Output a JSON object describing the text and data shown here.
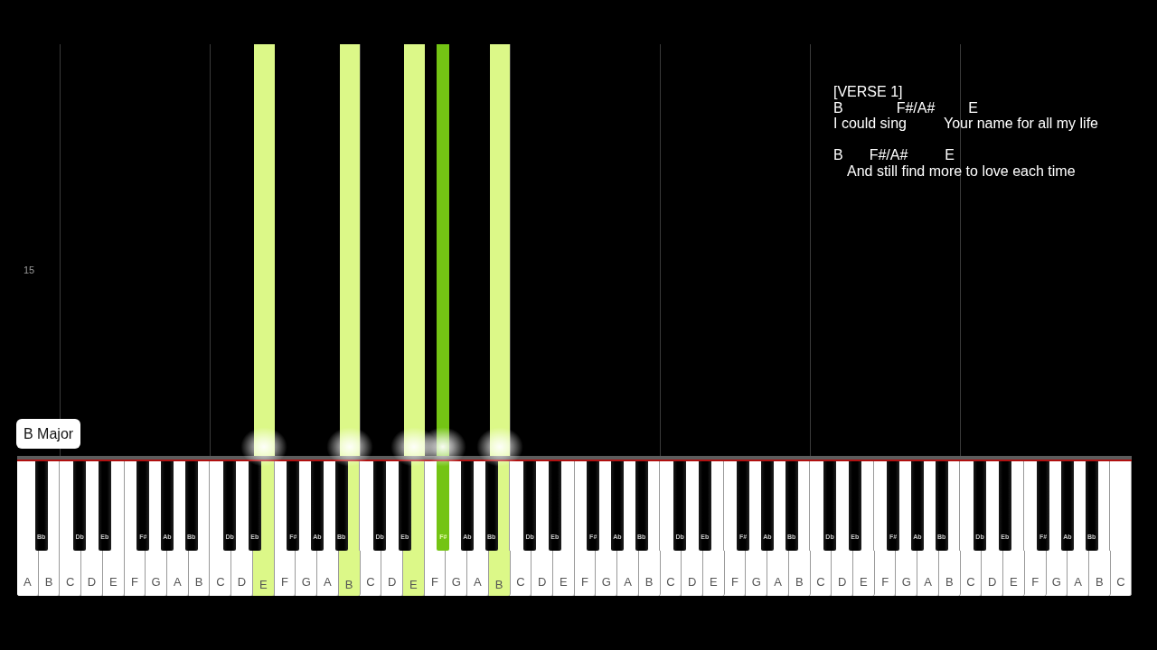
{
  "roll": {
    "measure_number": "15",
    "chord_label": "B Major"
  },
  "lyrics": {
    "section": "[VERSE 1]",
    "lines": [
      {
        "chords": [
          "B",
          "F#/A#",
          "E"
        ],
        "words": [
          "I could sing",
          "Your name for all my life"
        ]
      },
      {
        "chords": [
          "B",
          "F#/A#",
          "E"
        ],
        "words": [
          "And still find more to love each time"
        ]
      }
    ]
  },
  "keys": [
    {
      "kind": "white",
      "label": "A",
      "pressed": false
    },
    {
      "kind": "black",
      "label": "Bb",
      "pressed": false
    },
    {
      "kind": "white",
      "label": "B",
      "pressed": false
    },
    {
      "kind": "white",
      "label": "C",
      "pressed": false
    },
    {
      "kind": "black",
      "label": "Db",
      "pressed": false
    },
    {
      "kind": "white",
      "label": "D",
      "pressed": false
    },
    {
      "kind": "black",
      "label": "Eb",
      "pressed": false
    },
    {
      "kind": "white",
      "label": "E",
      "pressed": false
    },
    {
      "kind": "white",
      "label": "F",
      "pressed": false
    },
    {
      "kind": "black",
      "label": "F#",
      "pressed": false
    },
    {
      "kind": "white",
      "label": "G",
      "pressed": false
    },
    {
      "kind": "black",
      "label": "Ab",
      "pressed": false
    },
    {
      "kind": "white",
      "label": "A",
      "pressed": false
    },
    {
      "kind": "black",
      "label": "Bb",
      "pressed": false
    },
    {
      "kind": "white",
      "label": "B",
      "pressed": false
    },
    {
      "kind": "white",
      "label": "C",
      "pressed": false
    },
    {
      "kind": "black",
      "label": "Db",
      "pressed": false
    },
    {
      "kind": "white",
      "label": "D",
      "pressed": false
    },
    {
      "kind": "black",
      "label": "Eb",
      "pressed": false
    },
    {
      "kind": "white",
      "label": "E",
      "pressed": true,
      "color": "#dcf888"
    },
    {
      "kind": "white",
      "label": "F",
      "pressed": false
    },
    {
      "kind": "black",
      "label": "F#",
      "pressed": false
    },
    {
      "kind": "white",
      "label": "G",
      "pressed": false
    },
    {
      "kind": "black",
      "label": "Ab",
      "pressed": false
    },
    {
      "kind": "white",
      "label": "A",
      "pressed": false
    },
    {
      "kind": "black",
      "label": "Bb",
      "pressed": false
    },
    {
      "kind": "white",
      "label": "B",
      "pressed": true,
      "color": "#dcf888"
    },
    {
      "kind": "white",
      "label": "C",
      "pressed": false
    },
    {
      "kind": "black",
      "label": "Db",
      "pressed": false
    },
    {
      "kind": "white",
      "label": "D",
      "pressed": false
    },
    {
      "kind": "black",
      "label": "Eb",
      "pressed": false
    },
    {
      "kind": "white",
      "label": "E",
      "pressed": true,
      "color": "#dcf888"
    },
    {
      "kind": "white",
      "label": "F",
      "pressed": false
    },
    {
      "kind": "black",
      "label": "F#",
      "pressed": true,
      "color": "#74c414"
    },
    {
      "kind": "white",
      "label": "G",
      "pressed": false
    },
    {
      "kind": "black",
      "label": "Ab",
      "pressed": false
    },
    {
      "kind": "white",
      "label": "A",
      "pressed": false
    },
    {
      "kind": "black",
      "label": "Bb",
      "pressed": false
    },
    {
      "kind": "white",
      "label": "B",
      "pressed": true,
      "color": "#dcf888"
    },
    {
      "kind": "white",
      "label": "C",
      "pressed": false
    },
    {
      "kind": "black",
      "label": "Db",
      "pressed": false
    },
    {
      "kind": "white",
      "label": "D",
      "pressed": false
    },
    {
      "kind": "black",
      "label": "Eb",
      "pressed": false
    },
    {
      "kind": "white",
      "label": "E",
      "pressed": false
    },
    {
      "kind": "white",
      "label": "F",
      "pressed": false
    },
    {
      "kind": "black",
      "label": "F#",
      "pressed": false
    },
    {
      "kind": "white",
      "label": "G",
      "pressed": false
    },
    {
      "kind": "black",
      "label": "Ab",
      "pressed": false
    },
    {
      "kind": "white",
      "label": "A",
      "pressed": false
    },
    {
      "kind": "black",
      "label": "Bb",
      "pressed": false
    },
    {
      "kind": "white",
      "label": "B",
      "pressed": false
    },
    {
      "kind": "white",
      "label": "C",
      "pressed": false
    },
    {
      "kind": "black",
      "label": "Db",
      "pressed": false
    },
    {
      "kind": "white",
      "label": "D",
      "pressed": false
    },
    {
      "kind": "black",
      "label": "Eb",
      "pressed": false
    },
    {
      "kind": "white",
      "label": "E",
      "pressed": false
    },
    {
      "kind": "white",
      "label": "F",
      "pressed": false
    },
    {
      "kind": "black",
      "label": "F#",
      "pressed": false
    },
    {
      "kind": "white",
      "label": "G",
      "pressed": false
    },
    {
      "kind": "black",
      "label": "Ab",
      "pressed": false
    },
    {
      "kind": "white",
      "label": "A",
      "pressed": false
    },
    {
      "kind": "black",
      "label": "Bb",
      "pressed": false
    },
    {
      "kind": "white",
      "label": "B",
      "pressed": false
    },
    {
      "kind": "white",
      "label": "C",
      "pressed": false
    },
    {
      "kind": "black",
      "label": "Db",
      "pressed": false
    },
    {
      "kind": "white",
      "label": "D",
      "pressed": false
    },
    {
      "kind": "black",
      "label": "Eb",
      "pressed": false
    },
    {
      "kind": "white",
      "label": "E",
      "pressed": false
    },
    {
      "kind": "white",
      "label": "F",
      "pressed": false
    },
    {
      "kind": "black",
      "label": "F#",
      "pressed": false
    },
    {
      "kind": "white",
      "label": "G",
      "pressed": false
    },
    {
      "kind": "black",
      "label": "Ab",
      "pressed": false
    },
    {
      "kind": "white",
      "label": "A",
      "pressed": false
    },
    {
      "kind": "black",
      "label": "Bb",
      "pressed": false
    },
    {
      "kind": "white",
      "label": "B",
      "pressed": false
    },
    {
      "kind": "white",
      "label": "C",
      "pressed": false
    },
    {
      "kind": "black",
      "label": "Db",
      "pressed": false
    },
    {
      "kind": "white",
      "label": "D",
      "pressed": false
    },
    {
      "kind": "black",
      "label": "Eb",
      "pressed": false
    },
    {
      "kind": "white",
      "label": "E",
      "pressed": false
    },
    {
      "kind": "white",
      "label": "F",
      "pressed": false
    },
    {
      "kind": "black",
      "label": "F#",
      "pressed": false
    },
    {
      "kind": "white",
      "label": "G",
      "pressed": false
    },
    {
      "kind": "black",
      "label": "Ab",
      "pressed": false
    },
    {
      "kind": "white",
      "label": "A",
      "pressed": false
    },
    {
      "kind": "black",
      "label": "Bb",
      "pressed": false
    },
    {
      "kind": "white",
      "label": "B",
      "pressed": false
    },
    {
      "kind": "white",
      "label": "C",
      "pressed": false
    }
  ]
}
